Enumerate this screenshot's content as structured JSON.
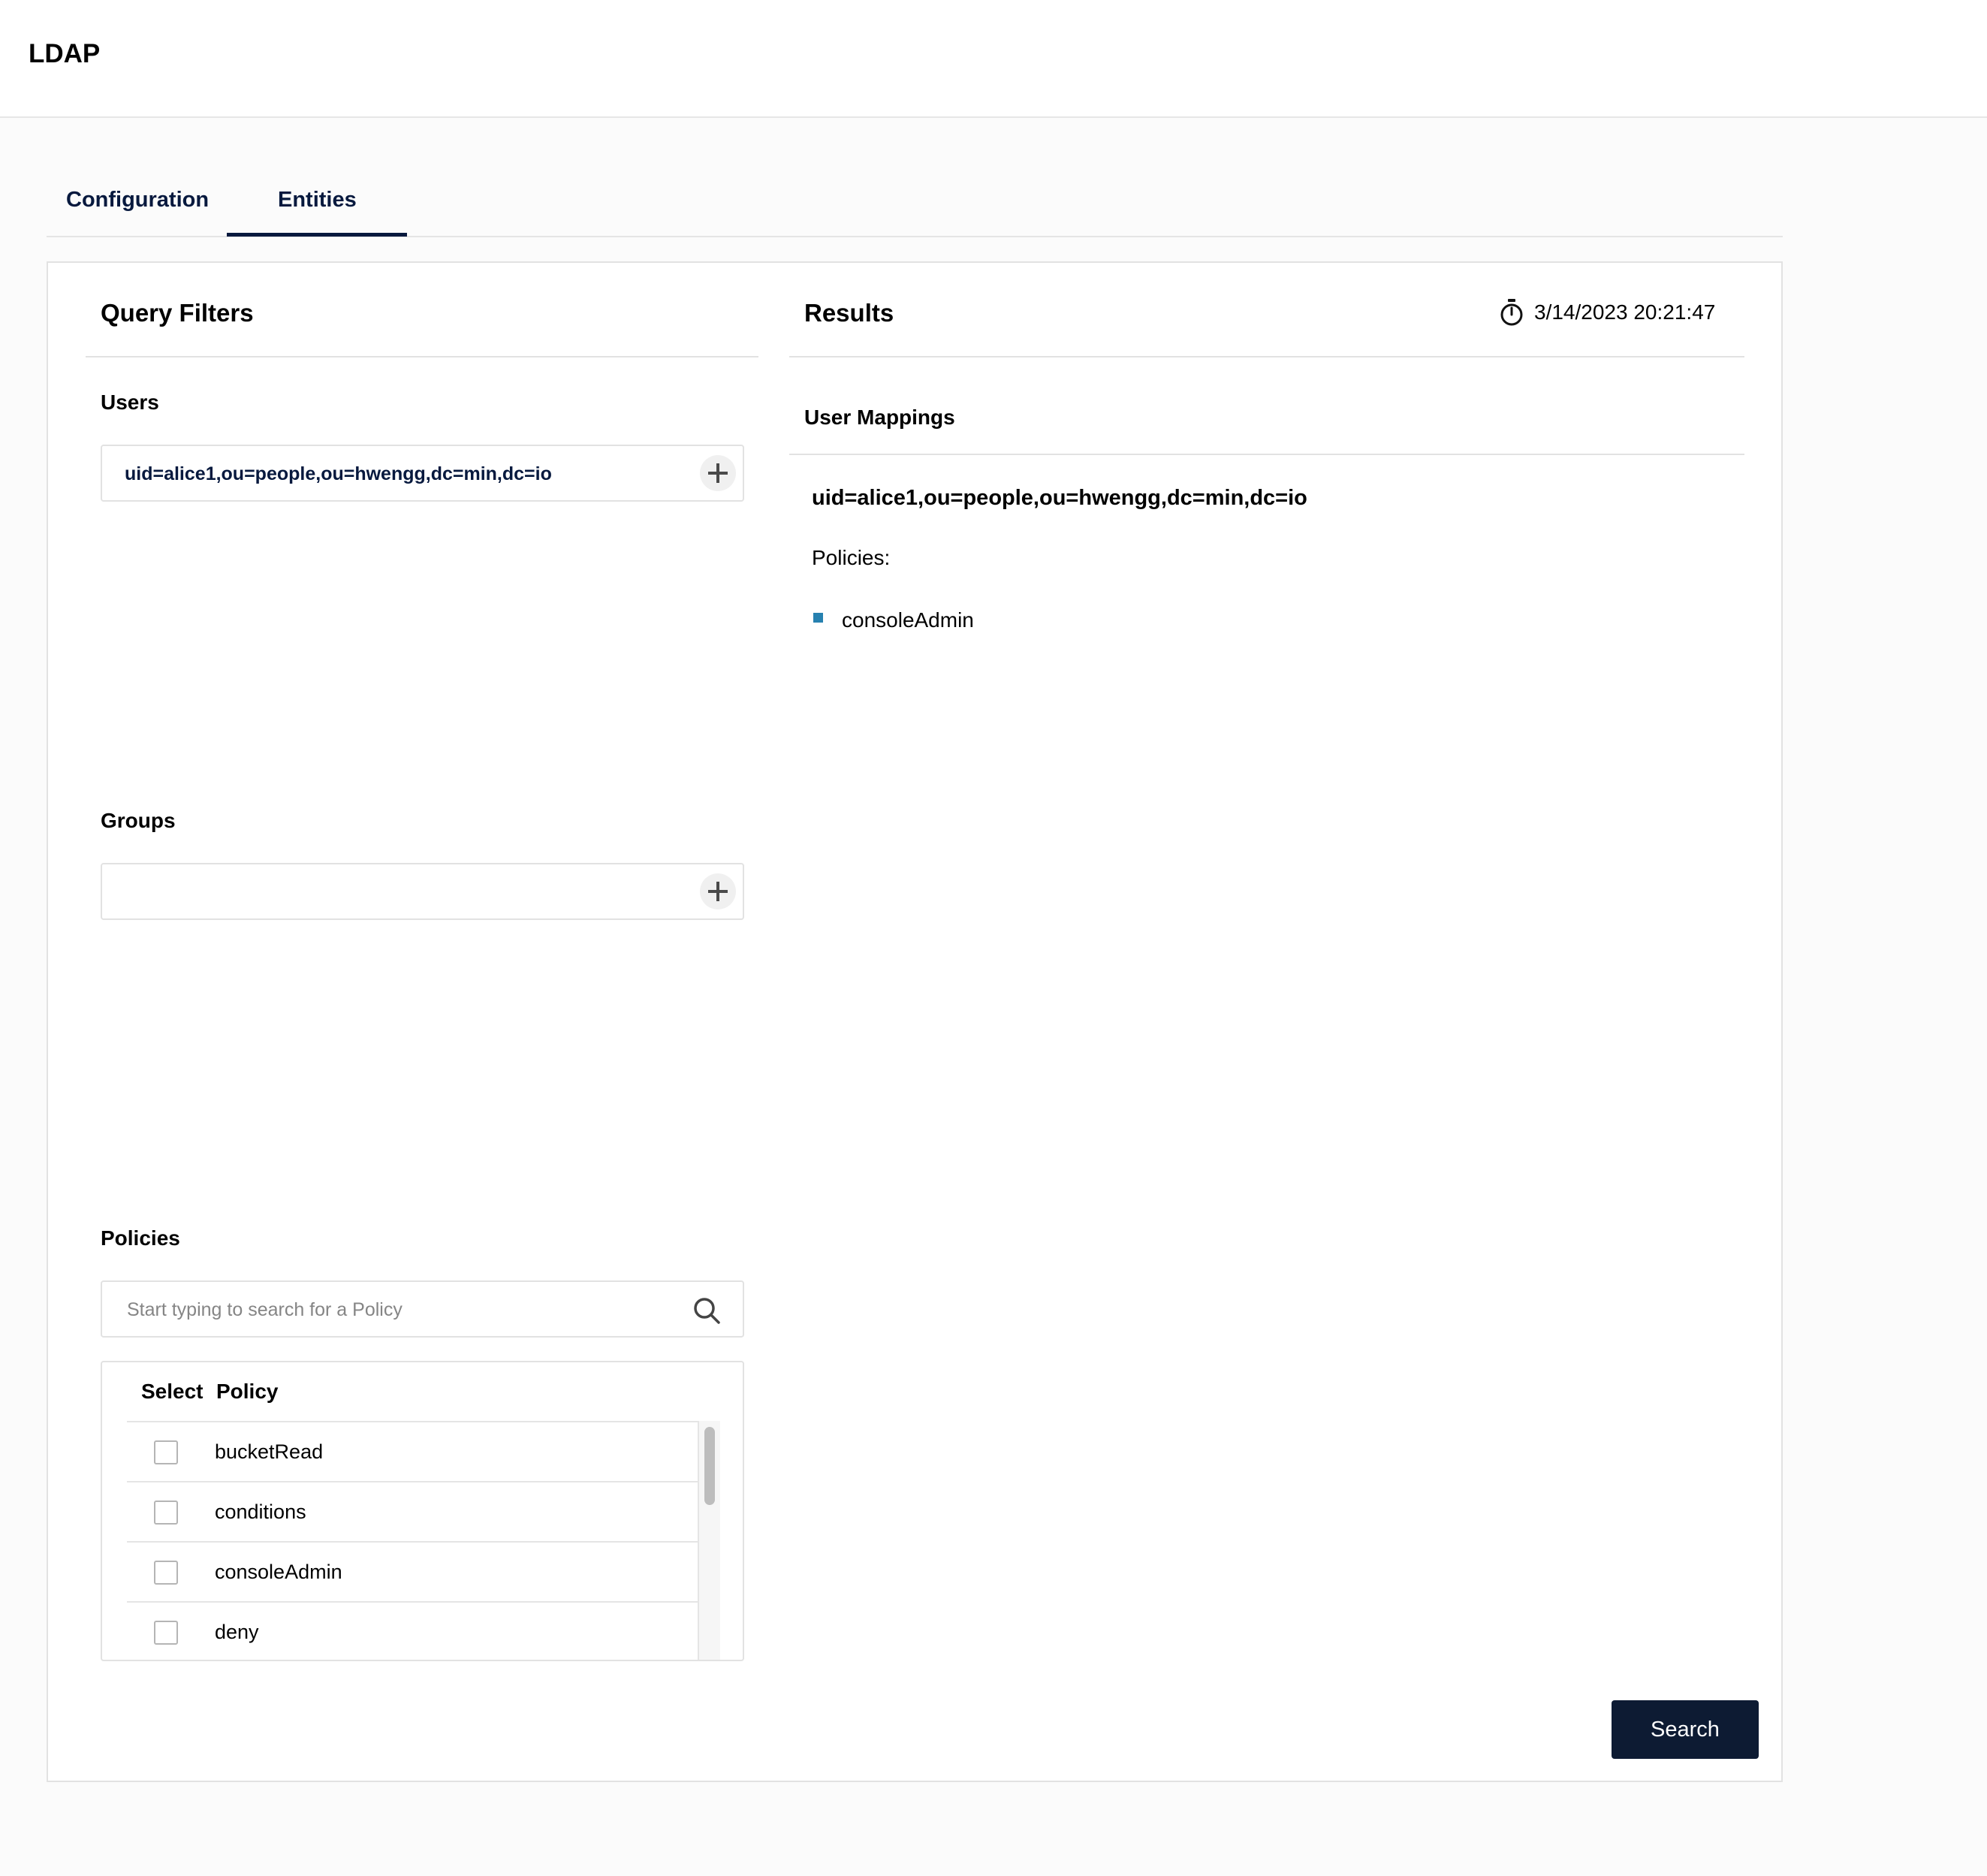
{
  "header": {
    "title": "LDAP"
  },
  "tabs": [
    {
      "label": "Configuration",
      "active": false
    },
    {
      "label": "Entities",
      "active": true
    }
  ],
  "query_filters": {
    "title": "Query Filters",
    "users": {
      "label": "Users",
      "value": "uid=alice1,ou=people,ou=hwengg,dc=min,dc=io"
    },
    "groups": {
      "label": "Groups",
      "value": ""
    },
    "policies": {
      "label": "Policies",
      "search_placeholder": "Start typing to search for a Policy",
      "table_header": {
        "select": "Select",
        "policy": "Policy"
      },
      "items": [
        "bucketRead",
        "conditions",
        "consoleAdmin",
        "deny"
      ]
    }
  },
  "results": {
    "title": "Results",
    "timestamp": "3/14/2023 20:21:47",
    "section_label": "User Mappings",
    "entry": {
      "dn": "uid=alice1,ou=people,ou=hwengg,dc=min,dc=io",
      "policies_label": "Policies:",
      "policies": [
        "consoleAdmin"
      ]
    }
  },
  "actions": {
    "search_label": "Search"
  },
  "colors": {
    "primary": "#07193e",
    "button": "#0d1b33",
    "bullet": "#2781b0",
    "border": "#e2e2e2"
  },
  "icons": {
    "add": "plus-icon",
    "search": "magnifier-icon",
    "timestamp": "stopwatch-icon"
  }
}
